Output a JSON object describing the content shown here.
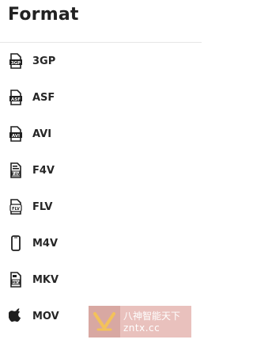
{
  "header": {
    "title": "Format"
  },
  "formats": [
    {
      "label": "3GP",
      "icon": "3gp-file-icon"
    },
    {
      "label": "ASF",
      "icon": "asf-file-icon"
    },
    {
      "label": "AVI",
      "icon": "avi-file-icon"
    },
    {
      "label": "F4V",
      "icon": "f4v-file-icon"
    },
    {
      "label": "FLV",
      "icon": "flv-file-icon"
    },
    {
      "label": "M4V",
      "icon": "phone-icon"
    },
    {
      "label": "MKV",
      "icon": "mkv-file-icon"
    },
    {
      "label": "MOV",
      "icon": "apple-icon"
    }
  ],
  "watermark": {
    "line1": "八神智能天下",
    "line2": "zntx.cc"
  },
  "colors": {
    "text": "#222222",
    "divider": "#e6e6e6",
    "icon": "#1f1f1f",
    "watermark_bg": "#e9c1bd"
  }
}
